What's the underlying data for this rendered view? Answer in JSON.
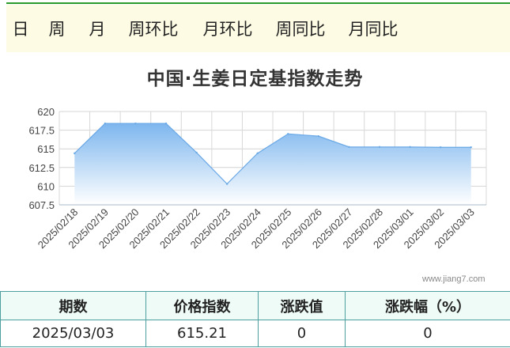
{
  "tabs": [
    {
      "label": "日",
      "active": true
    },
    {
      "label": "周",
      "active": false
    },
    {
      "label": "月",
      "active": false
    },
    {
      "label": "周环比",
      "active": false
    },
    {
      "label": "月环比",
      "active": false
    },
    {
      "label": "周同比",
      "active": false
    },
    {
      "label": "月同比",
      "active": false
    }
  ],
  "colors": {
    "accent": "#0d8f1f",
    "tab_bg": "#fdfbe4",
    "area_top": "#7db6ee",
    "line": "#6aa9e6"
  },
  "chart_data": {
    "type": "area",
    "title": "中国·生姜日定基指数走势",
    "xlabel": "",
    "ylabel": "",
    "x": [
      "2025/02/18",
      "2025/02/19",
      "2025/02/20",
      "2025/02/21",
      "2025/02/22",
      "2025/02/23",
      "2025/02/24",
      "2025/02/25",
      "2025/02/26",
      "2025/02/27",
      "2025/02/28",
      "2025/03/01",
      "2025/03/02",
      "2025/03/03"
    ],
    "series": [
      {
        "values": [
          614.4,
          618.4,
          618.4,
          618.4,
          614.5,
          610.3,
          614.4,
          617.0,
          616.7,
          615.25,
          615.25,
          615.25,
          615.21,
          615.21
        ]
      }
    ],
    "ylim": [
      607.5,
      620
    ],
    "yticks": [
      620,
      617.5,
      615,
      612.5,
      610,
      607.5
    ],
    "ytick_labels": [
      "620",
      "617.5",
      "615",
      "612.5",
      "610",
      "607.5"
    ],
    "grid": true
  },
  "watermark": "www.jiang7.com",
  "summary": {
    "headers": [
      "期数",
      "价格指数",
      "涨跌值",
      "涨跌幅（%）"
    ],
    "row": [
      "2025/03/03",
      "615.21",
      "0",
      "0"
    ]
  }
}
